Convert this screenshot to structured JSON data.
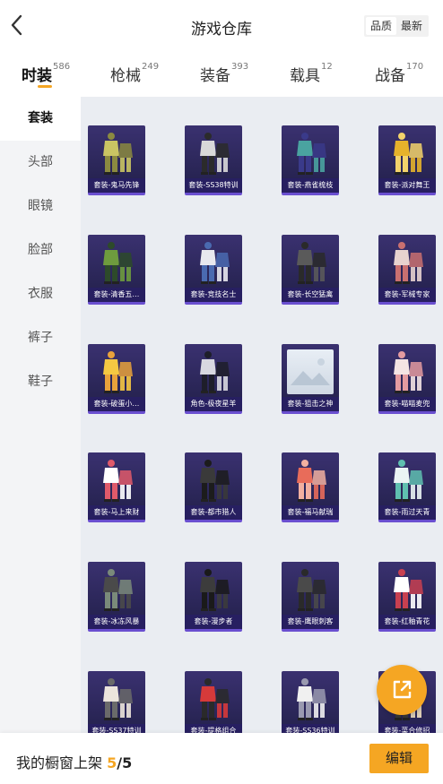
{
  "header": {
    "title": "游戏仓库",
    "sort": {
      "quality_label": "品质",
      "latest_label": "最新",
      "selected": "品质"
    }
  },
  "tabs": [
    {
      "label": "时装",
      "count": "586",
      "active": true
    },
    {
      "label": "枪械",
      "count": "249",
      "active": false
    },
    {
      "label": "装备",
      "count": "393",
      "active": false
    },
    {
      "label": "载具",
      "count": "12",
      "active": false
    },
    {
      "label": "战备",
      "count": "170",
      "active": false
    }
  ],
  "sidebar": {
    "items": [
      {
        "label": "套装",
        "active": true
      },
      {
        "label": "头部",
        "active": false
      },
      {
        "label": "眼镜",
        "active": false
      },
      {
        "label": "脸部",
        "active": false
      },
      {
        "label": "衣服",
        "active": false
      },
      {
        "label": "裤子",
        "active": false
      },
      {
        "label": "鞋子",
        "active": false
      }
    ]
  },
  "items": [
    {
      "name": "套装-鬼马先锋",
      "icon": "outfit-icon",
      "colors": [
        "#c9c463",
        "#8b8a40"
      ]
    },
    {
      "name": "套装-SS38特训",
      "icon": "outfit-icon",
      "colors": [
        "#d9d9d9",
        "#2b2b2b"
      ]
    },
    {
      "name": "套装-燕雀梳枝",
      "icon": "outfit-icon",
      "colors": [
        "#4aa3a0",
        "#3a3a8a"
      ]
    },
    {
      "name": "套装-派对舞王",
      "icon": "outfit-icon",
      "colors": [
        "#e6b22b",
        "#f3d36b"
      ]
    },
    {
      "name": "套装-清香五…",
      "icon": "outfit-icon",
      "colors": [
        "#6e9b3e",
        "#2d4a2a"
      ]
    },
    {
      "name": "套装-竞技名士",
      "icon": "outfit-icon",
      "colors": [
        "#e8e8ee",
        "#4a6ab0"
      ]
    },
    {
      "name": "套装-长空猛禽",
      "icon": "outfit-icon",
      "colors": [
        "#5a5a5a",
        "#2a2a2a"
      ]
    },
    {
      "name": "套装-军械专家",
      "icon": "outfit-icon",
      "colors": [
        "#e7d3cf",
        "#c97070"
      ]
    },
    {
      "name": "套装-破蛋小…",
      "icon": "outfit-icon",
      "colors": [
        "#f5c842",
        "#e9a23b"
      ]
    },
    {
      "name": "角色-极夜星羊",
      "icon": "outfit-icon",
      "colors": [
        "#d8d8e0",
        "#1e1e2a"
      ]
    },
    {
      "name": "套装-狙击之神",
      "icon": "image-placeholder-icon",
      "colors": [
        "#e8eef5",
        "#cfd8e3"
      ]
    },
    {
      "name": "套装-喵喵麦兜",
      "icon": "outfit-icon",
      "colors": [
        "#f4e4e4",
        "#e49ba0"
      ]
    },
    {
      "name": "套装-马上来财",
      "icon": "outfit-icon",
      "colors": [
        "#ffffff",
        "#e05a6a"
      ]
    },
    {
      "name": "套装-都市猎人",
      "icon": "outfit-icon",
      "colors": [
        "#3a3a3a",
        "#1c1c1c"
      ]
    },
    {
      "name": "套装-福马献瑞",
      "icon": "outfit-icon",
      "colors": [
        "#e86c5a",
        "#f2b0a0"
      ]
    },
    {
      "name": "套装-雨过天青",
      "icon": "outfit-icon",
      "colors": [
        "#eaf4f4",
        "#5fc0b0"
      ]
    },
    {
      "name": "套装-冰冻风暴",
      "icon": "outfit-icon",
      "colors": [
        "#4a4a4a",
        "#7a8a7a"
      ]
    },
    {
      "name": "套装-漫步者",
      "icon": "outfit-icon",
      "colors": [
        "#3c3c3c",
        "#1a1a1a"
      ]
    },
    {
      "name": "套装-鹰眼刺客",
      "icon": "outfit-icon",
      "colors": [
        "#4a4a4a",
        "#2a2a2a"
      ]
    },
    {
      "name": "套装-红釉青花",
      "icon": "outfit-icon",
      "colors": [
        "#ffffff",
        "#c84050"
      ]
    },
    {
      "name": "套装-SS37特训",
      "icon": "outfit-icon",
      "colors": [
        "#ece4dc",
        "#6a6a6a"
      ]
    },
    {
      "name": "套装-提格组合",
      "icon": "outfit-icon",
      "colors": [
        "#d63a3a",
        "#2a2a2a"
      ]
    },
    {
      "name": "套装-SS36特训",
      "icon": "outfit-icon",
      "colors": [
        "#f0f0f0",
        "#9a9ab0"
      ]
    },
    {
      "name": "套装-菜合修招",
      "icon": "outfit-icon",
      "colors": [
        "#f0e0c0",
        "#3a3a3a"
      ]
    }
  ],
  "fab": {
    "icon": "share-export-icon"
  },
  "bottom": {
    "prefix": "我的橱窗上架",
    "current": "5",
    "separator": "/",
    "total": "5",
    "edit_label": "编辑"
  },
  "colors": {
    "accent": "#f5a623",
    "card_bg": "#2e2860",
    "sidebar_bg": "#f3f4f6",
    "content_bg": "#eaedf2"
  }
}
